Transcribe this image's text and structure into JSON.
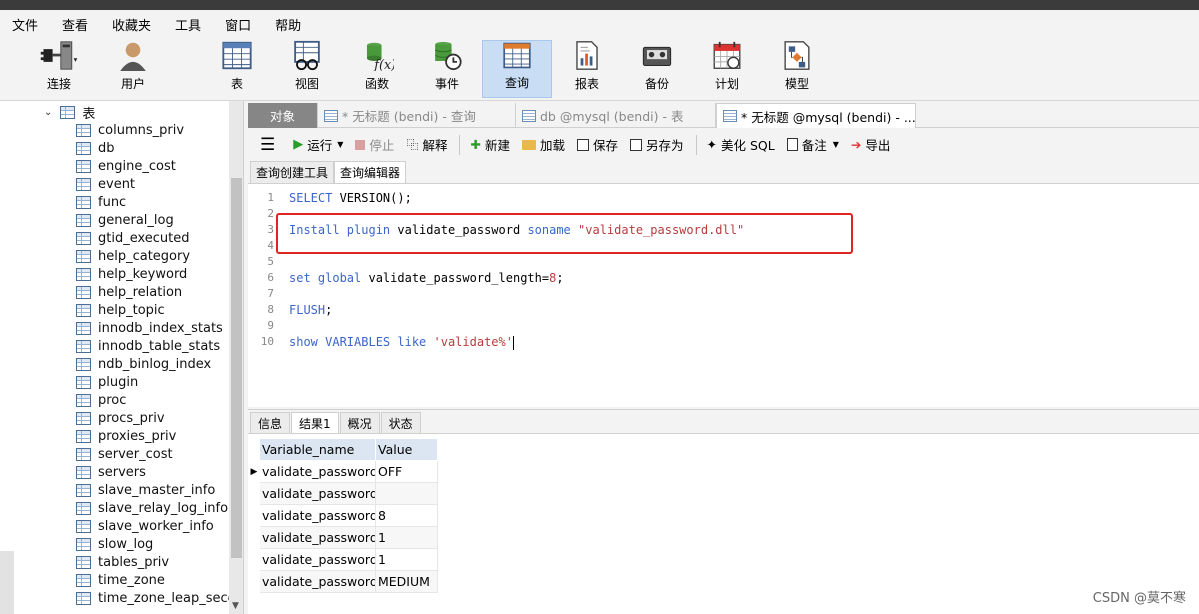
{
  "menu": [
    "文件",
    "查看",
    "收藏夹",
    "工具",
    "窗口",
    "帮助"
  ],
  "toolbar": {
    "connect": "连接",
    "user": "用户",
    "table": "表",
    "view": "视图",
    "function": "函数",
    "event": "事件",
    "query": "查询",
    "report": "报表",
    "backup": "备份",
    "schedule": "计划",
    "model": "模型"
  },
  "sidebar": {
    "root_label": "表",
    "items": [
      "columns_priv",
      "db",
      "engine_cost",
      "event",
      "func",
      "general_log",
      "gtid_executed",
      "help_category",
      "help_keyword",
      "help_relation",
      "help_topic",
      "innodb_index_stats",
      "innodb_table_stats",
      "ndb_binlog_index",
      "plugin",
      "proc",
      "procs_priv",
      "proxies_priv",
      "server_cost",
      "servers",
      "slave_master_info",
      "slave_relay_log_info",
      "slave_worker_info",
      "slow_log",
      "tables_priv",
      "time_zone",
      "time_zone_leap_second"
    ]
  },
  "tabs": {
    "objects": "对象",
    "t1": "* 无标题 (bendi) - 查询",
    "t2": "db @mysql (bendi) - 表",
    "t3": "* 无标题 @mysql (bendi) - ..."
  },
  "query_toolbar": {
    "run": "运行",
    "stop": "停止",
    "explain": "解释",
    "new": "新建",
    "load": "加载",
    "save": "保存",
    "save_as": "另存为",
    "beautify": "美化 SQL",
    "comment": "备注",
    "export": "导出"
  },
  "subtabs": {
    "builder": "查询创建工具",
    "editor": "查询编辑器"
  },
  "editor": {
    "line_numbers": [
      "1",
      "2",
      "3",
      "4",
      "5",
      "6",
      "7",
      "8",
      "9",
      "10"
    ],
    "l1": {
      "kw": "SELECT",
      "rest": " VERSION();"
    },
    "l3": {
      "kw1": "Install plugin",
      "mid": " validate_password ",
      "kw2": "soname",
      "str": " \"validate_password.dll\""
    },
    "l6": {
      "kw1": "set global",
      "mid": " validate_password_length=",
      "num": "8",
      "end": ";"
    },
    "l8": {
      "kw": "FLUSH",
      "end": ";"
    },
    "l10": {
      "kw": "show VARIABLES like",
      "str": " 'validate%'"
    }
  },
  "result_tabs": {
    "info": "信息",
    "result1": "结果1",
    "overview": "概况",
    "status": "状态"
  },
  "results": {
    "columns": [
      "Variable_name",
      "Value"
    ],
    "rows": [
      [
        "validate_password_",
        "OFF"
      ],
      [
        "validate_password_",
        ""
      ],
      [
        "validate_password_",
        "8"
      ],
      [
        "validate_password_",
        "1"
      ],
      [
        "validate_password_",
        "1"
      ],
      [
        "validate_password_",
        "MEDIUM"
      ]
    ]
  },
  "watermark": "CSDN @莫不寒"
}
